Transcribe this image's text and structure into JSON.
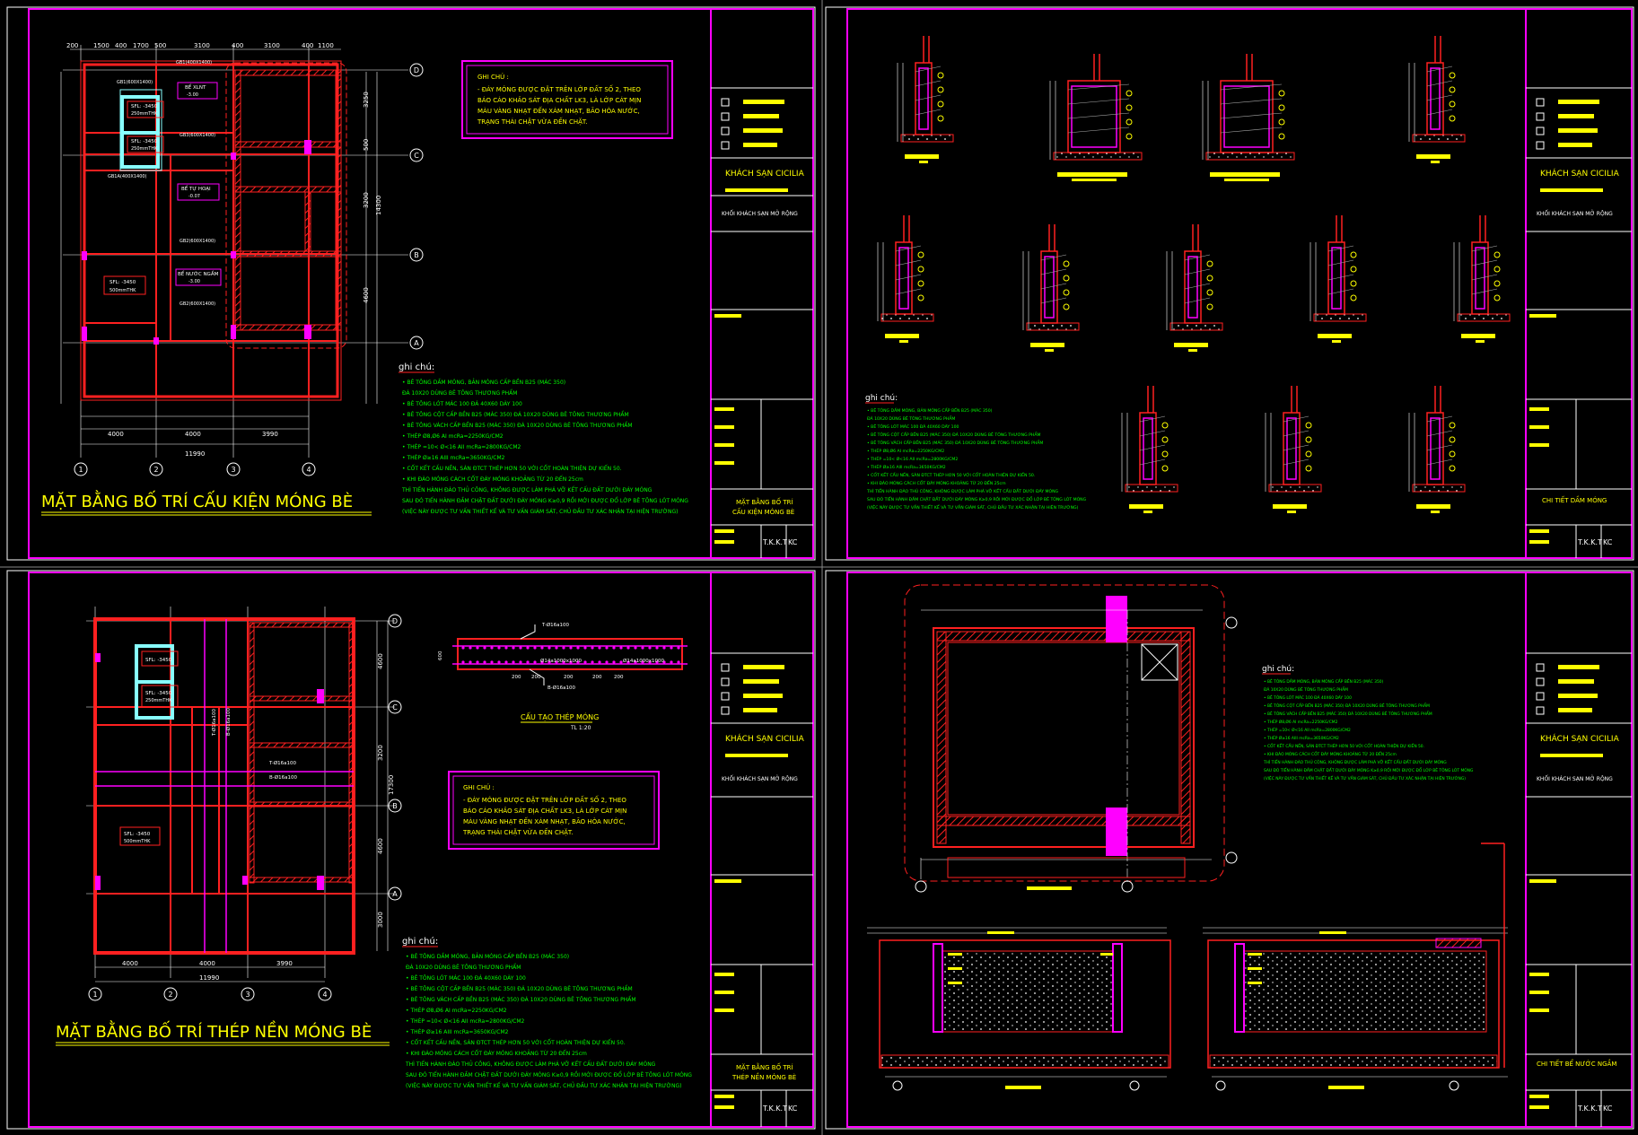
{
  "project": {
    "name": "KHÁCH SẠN CICILIA",
    "block": "KHỐI KHÁCH SẠN MỞ RỘNG",
    "designer_code": "T.K.K.T",
    "sheet_code": "KC"
  },
  "sheets": [
    {
      "title": "MẶT BẰNG BỐ TRÍ CẤU KIỆN MÓNG BÈ",
      "titleblock_title_1": "MẶT BẰNG BỐ TRÍ",
      "titleblock_title_2": "CẤU KIỆN MÓNG BÈ",
      "total_width": "11990",
      "bottom_dims": [
        "4000",
        "4000",
        "3990"
      ],
      "top_dims": [
        "200",
        "1500",
        "400",
        "1700",
        "500",
        "3100",
        "400",
        "3100",
        "400",
        "1100"
      ],
      "grid_cols": [
        "1",
        "2",
        "3",
        "4"
      ],
      "grid_rows": [
        "D",
        "C",
        "B",
        "A"
      ],
      "right_dims": [
        "3250",
        "500",
        "3200",
        "14300",
        "4600"
      ],
      "labels": [
        {
          "text": "SFL: -3450",
          "sub": "250mmTHK"
        },
        {
          "text": "SFL: -3450",
          "sub": "250mmTHK"
        },
        {
          "text": "SFL: -3450",
          "sub": "500mmTHK"
        },
        {
          "text": "BỂ XLNT",
          "sub": "-3.00"
        },
        {
          "text": "BỂ TỰ HOẠI",
          "sub": "-0.07"
        },
        {
          "text": "BỂ NƯỚC NGẦM",
          "sub": "-3.00"
        }
      ],
      "beams": [
        "GB1(400X1400)",
        "GB1(600X1400)",
        "GB3(600X1400)",
        "GB1A(400X1400)",
        "GB2(600X1400)",
        "GB2(600X1400)"
      ]
    },
    {
      "title": "CHI TIẾT DẦM MÓNG",
      "titleblock_title_1": "CHI TIẾT DẦM MÓNG",
      "titleblock_title_2": ""
    },
    {
      "title": "MẶT BẰNG BỐ TRÍ THÉP NỀN MÓNG BÈ",
      "titleblock_title_1": "MẶT BẰNG BỐ TRÍ",
      "titleblock_title_2": "THÉP NỀN MÓNG BÈ",
      "total_width": "11990",
      "bottom_dims": [
        "4000",
        "4000",
        "3990"
      ],
      "grid_cols": [
        "1",
        "2",
        "3",
        "4"
      ],
      "grid_rows": [
        "D",
        "C",
        "B",
        "A"
      ],
      "right_dims": [
        "4600",
        "3200",
        "17300",
        "4600",
        "3000"
      ],
      "rebar_labels": [
        "T-Ø16a100",
        "B-Ø16a100",
        "T-Ø16a100",
        "B-Ø16a100"
      ],
      "section": {
        "title": "CẤU TẠO THÉP MÓNG",
        "scale": "TL 1:20",
        "top_label": "T-Ø16a100",
        "bottom_label": "B-Ø16a100",
        "mid_labels": [
          "Ø14a1000x1000",
          "Ø14a1000x1000"
        ],
        "dims": [
          "200",
          "200",
          "200",
          "200",
          "200"
        ],
        "height": "600"
      }
    },
    {
      "title": "CHI TIẾT BỂ NƯỚC NGẦM",
      "titleblock_title_1": "CHI TIẾT BỂ NƯỚC NGẦM",
      "titleblock_title_2": ""
    }
  ],
  "note_box": {
    "heading": "GHI CHÚ :",
    "lines": [
      "- ĐÁY MÓNG ĐƯỢC ĐẶT TRÊN LỚP ĐẤT SỐ 2, THEO",
      "BÁO CÁO KHẢO SÁT ĐỊA CHẤT LK3, LÀ LỚP CÁT MỊN",
      "MÀU VÀNG NHẠT ĐẾN XÁM NHẠT, BÃO HÒA NƯỚC,",
      "TRẠNG THÁI CHẶT VỪA ĐẾN CHẶT."
    ]
  },
  "notes": {
    "heading": "ghi chú:",
    "lines": [
      "• BÊ TÔNG DẦM MÓNG, BẢN MÓNG CẤP BỀN B25 (MÁC 350)",
      "  ĐÁ 10X20 DÙNG BÊ TÔNG THƯƠNG PHẨM",
      "• BÊ TÔNG LÓT MÁC 100 ĐÁ 40X60 DÀY 100",
      "• BÊ TÔNG CỘT CẤP BỀN B25 (MÁC 350) ĐÁ 10X20 DÙNG BÊ TÔNG THƯƠNG PHẨM",
      "• BÊ TÔNG VÁCH CẤP BỀN B25 (MÁC 350) ĐÁ 10X20 DÙNG BÊ TÔNG THƯƠNG PHẨM",
      "• THÉP Ø8,Ø6 AI mcRa=2250KG/CM2",
      "• THÉP =10< Ø<16 AII mcRa=2800KG/CM2",
      "• THÉP Ø≥16 AIII mcRa=3650KG/CM2",
      "• CỐT KẾT CẤU NỀN, SÀN ĐTCT THÉP HƠN 50 VỚI CỐT HOÀN THIỆN DỰ KIẾN 50.",
      "• KHI ĐÀO MÓNG CÁCH CỐT ĐÁY MÓNG KHOẢNG TỪ 20 ĐẾN 25cm",
      "  THÌ TIẾN HÀNH ĐÀO THỦ CÔNG, KHÔNG ĐƯỢC LÀM PHÁ VỠ KẾT CẤU ĐẤT DƯỚI ĐÁY MÓNG",
      "  SAU ĐÓ TIẾN HÀNH ĐẦM CHẶT ĐẤT DƯỚI ĐÁY MÓNG K≥0,9 RỒI MỚI ĐƯỢC ĐỔ LỚP BÊ TÔNG LÓT MÓNG",
      "  (VIỆC NÀY ĐƯỢC TƯ VẤN THIẾT KẾ VÀ TƯ VẤN GIÁM SÁT, CHỦ ĐẦU TƯ XÁC NHẬN TẠI HIỆN TRƯỜNG)"
    ]
  },
  "colors": {
    "background": "#000000",
    "frame": "#ff00ff",
    "wall": "#ff2020",
    "text_green": "#00ff00",
    "text_yellow": "#ffff00",
    "dim_white": "#ffffff",
    "cyan": "#8ff"
  }
}
